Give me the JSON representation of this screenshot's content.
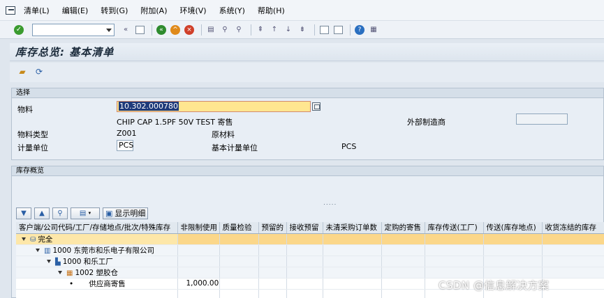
{
  "menu": [
    "清单(L)",
    "编辑(E)",
    "转到(G)",
    "附加(A)",
    "环境(V)",
    "系统(Y)",
    "帮助(H)"
  ],
  "title": "库存总览: 基本清单",
  "selection": {
    "header": "选择",
    "material_label": "物料",
    "material_value": "10.302.000780",
    "material_desc": "CHIP CAP 1.5PF 50V TEST 寄售",
    "ext_mfr_label": "外部制造商",
    "mat_type_label": "物料类型",
    "mat_type_value": "Z001",
    "mat_type_desc": "原材料",
    "unit_label": "计量单位",
    "unit_value": "PCS",
    "base_unit_label": "基本计量单位",
    "base_unit_value": "PCS"
  },
  "overview": {
    "header": "库存概览",
    "dots": ".....",
    "show_detail": "显示明细",
    "columns": [
      "客户端/公司代码/工厂/存储地点/批次/特殊库存",
      "非限制使用",
      "质量检验",
      "预留的",
      "接收预留",
      "未清采购订单数",
      "定购的寄售",
      "库存传送(工厂)",
      "传送(库存地点)",
      "收货冻结的库存"
    ],
    "rows": [
      {
        "label": "完全",
        "unrestricted": ""
      },
      {
        "label": "1000 东莞市和乐电子有限公司",
        "unrestricted": ""
      },
      {
        "label": "1000 和乐工厂",
        "unrestricted": ""
      },
      {
        "label": "1002 塑胶仓",
        "unrestricted": ""
      },
      {
        "label": "供应商寄售",
        "unrestricted": "1,000.000"
      }
    ]
  },
  "watermark": "CSDN @信息解决方案"
}
